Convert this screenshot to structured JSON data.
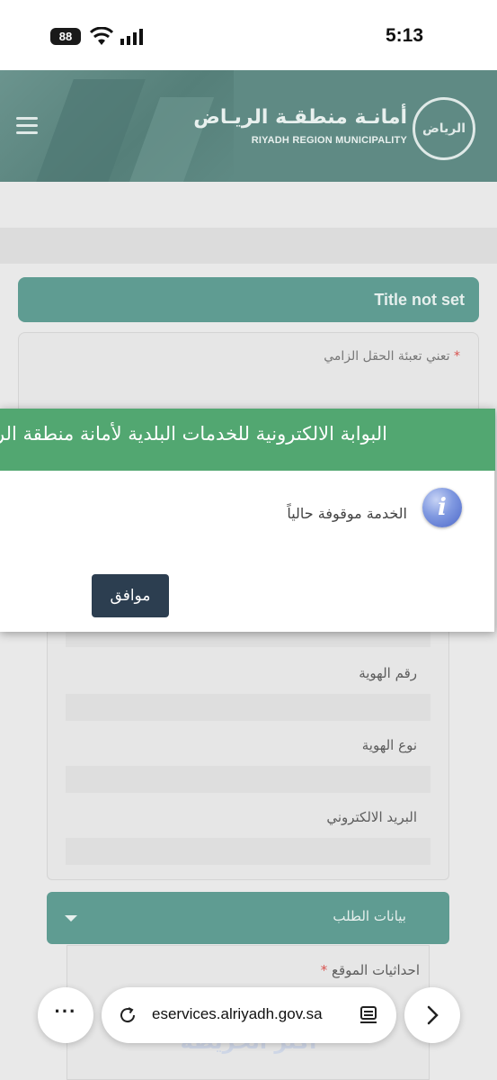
{
  "status_bar": {
    "battery": "88",
    "time": "5:13"
  },
  "header": {
    "logo_arabic": "أمانـة منطقـة الريـاض",
    "logo_english": "RIYADH REGION MUNICIPALITY",
    "logo_emblem_text": "الرياض"
  },
  "form": {
    "title": "Title not set",
    "required_note": "تعني تعبئة الحقل الزامي",
    "required_mark": "*",
    "fields": [
      {
        "label": "رقم الهوية"
      },
      {
        "label": "نوع الهوية"
      },
      {
        "label": "البريد الالكتروني"
      }
    ],
    "section_title": "بيانات الطلب",
    "coords_label": "احداثيات الموقع",
    "map_logo_text": "أكثر الخريطة"
  },
  "dialog": {
    "title": "البوابة الالكترونية للخدمات البلدية لأمانة منطقة الرياض",
    "icon": "info-icon",
    "message": "الخدمة موقوفة حالياً",
    "ok_label": "موافق"
  },
  "browser": {
    "more_label": "···",
    "url": "eservices.alriyadh.gov.sa"
  },
  "colors": {
    "header_bg": "#5f8a84",
    "accent_teal": "#5f9c92",
    "dialog_header": "#52a771",
    "ok_button": "#2c3e50"
  }
}
